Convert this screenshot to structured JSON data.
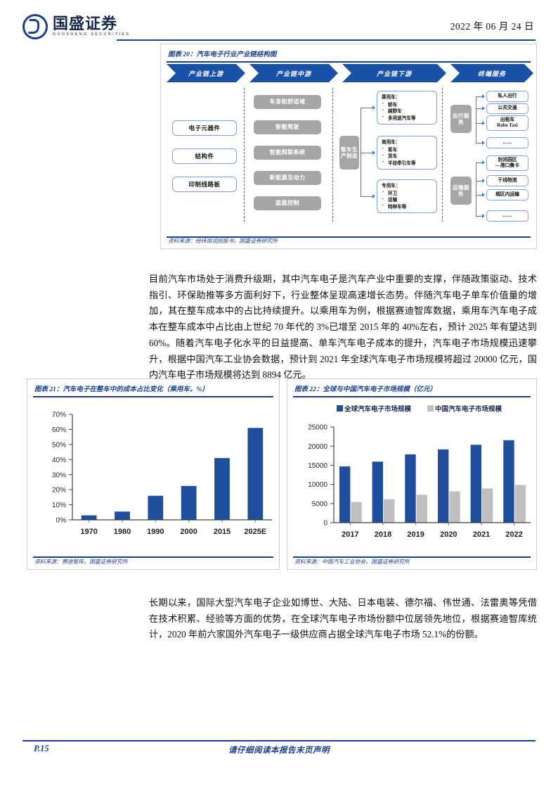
{
  "header": {
    "logo_cn": "国盛证券",
    "logo_en": "GUOSHENG SECURITIES",
    "date": "2022 年 06 月 24 日"
  },
  "fig20": {
    "title": "图表 20：汽车电子行业产业链结构图",
    "source": "资料来源：经纬恒润招股书，国盛证券研究所",
    "stages": [
      "产业链上游",
      "产业链中游",
      "产业链下游",
      "终端服务"
    ],
    "upstream": [
      "电子元器件",
      "结构件",
      "印制线路板"
    ],
    "midstream": [
      "车身和舒适域",
      "智能驾驶",
      "智能网联系统",
      "新能源及动力",
      "底盘控制"
    ],
    "downstream_hub": "整车生产制造",
    "downstream_groups": [
      {
        "head": "乘用车：",
        "items": [
          "轿车",
          "越野车",
          "多用途汽车等"
        ]
      },
      {
        "head": "商用车：",
        "items": [
          "客车",
          "货车",
          "半挂牵引车等"
        ]
      },
      {
        "head": "专用车：",
        "items": [
          "环卫",
          "运输",
          "特种车等"
        ]
      }
    ],
    "service_groups": [
      {
        "hub": "出行服务",
        "items": [
          "私人出行",
          "公共交通",
          "出租车\nRobo Taxi",
          "……"
        ]
      },
      {
        "hub": "运输服务",
        "items": [
          "封闭园区\n—港口集卡",
          "干线物流",
          "城区内运输",
          "……"
        ]
      }
    ]
  },
  "paragraphs": {
    "p1": "目前汽车市场处于消费升级期，其中汽车电子是汽车产业中重要的支撑，伴随政策驱动、技术指引、环保助推等多方面利好下，行业整体呈现高速增长态势。伴随汽车电子单车价值量的增加，其在整车成本中的占比持续提升。以乘用车为例，根据赛迪智库数据，乘用车汽车电子成本在整车成本中占比由上世纪 70 年代的 3%已增至 2015 年的 40%左右，预计 2025 年有望达到 60%。随着汽车电子化水平的日益提高、单车汽车电子成本的提升，汽车电子市场规模迅速攀升，根据中国汽车工业协会数据，预计到 2021 年全球汽车电子市场规模将超过 20000 亿元，国内汽车电子市场规模将达到 8894 亿元。",
    "p2": "长期以来，国际大型汽车电子企业如博世、大陆、日本电装、德尔福、伟世通、法雷奥等凭借在技术积累、经验等方面的优势，在全球汽车电子市场份额中位居领先地位，根据赛迪智库统计，2020 年前六家国外汽车电子一级供应商占据全球汽车电子市场 52.1%的份额。"
  },
  "fig21": {
    "title": "图表 21：汽车电子在整车中的成本占比变化（乘用车，%）",
    "source": "资料来源：赛迪智库，国盛证券研究所"
  },
  "fig22": {
    "title": "图表 22：全球与中国汽车电子市场规模（亿元）",
    "source": "资料来源：中国汽车工业协会，国盛证券研究所"
  },
  "colors": {
    "brand_blue": "#1a3f8f",
    "bar_blue": "#1f4e9c",
    "bar_gray": "#bfbfbf",
    "chevron_blue": "#1a51a8"
  },
  "footer": {
    "page": "P.15",
    "note": "请仔细阅读本报告末页声明"
  },
  "chart_data": [
    {
      "type": "bar",
      "id": "fig21",
      "title": "图表 21：汽车电子在整车中的成本占比变化（乘用车，%）",
      "categories": [
        "1970",
        "1980",
        "1990",
        "2000",
        "2015",
        "2025E"
      ],
      "values": [
        3,
        5.5,
        16,
        22.5,
        41,
        61
      ],
      "value_unit": "%",
      "xlabel": "",
      "ylabel": "",
      "ylim": [
        0,
        70
      ],
      "yticks": [
        0,
        10,
        20,
        30,
        40,
        50,
        60,
        70
      ],
      "ytick_labels": [
        "0%",
        "10%",
        "20%",
        "30%",
        "40%",
        "50%",
        "60%",
        "70%"
      ],
      "grid": false,
      "legend": null,
      "series_color": "#1f4e9c"
    },
    {
      "type": "bar",
      "id": "fig22",
      "title": "图表 22：全球与中国汽车电子市场规模（亿元）",
      "categories": [
        "2017",
        "2018",
        "2019",
        "2020",
        "2021",
        "2022"
      ],
      "series": [
        {
          "name": "全球汽车电子市场规模",
          "values": [
            14700,
            15950,
            17850,
            19150,
            20350,
            21550
          ],
          "color": "#1f4e9c"
        },
        {
          "name": "中国汽车电子市场规模",
          "values": [
            5400,
            6150,
            7300,
            8200,
            8950,
            9850
          ],
          "color": "#bfbfbf"
        }
      ],
      "value_unit": "亿元",
      "xlabel": "",
      "ylabel": "",
      "ylim": [
        0,
        25000
      ],
      "yticks": [
        0,
        5000,
        10000,
        15000,
        20000,
        25000
      ],
      "ytick_labels": [
        "0",
        "5000",
        "10000",
        "15000",
        "20000",
        "25000"
      ],
      "grid": false,
      "legend": "top"
    }
  ]
}
